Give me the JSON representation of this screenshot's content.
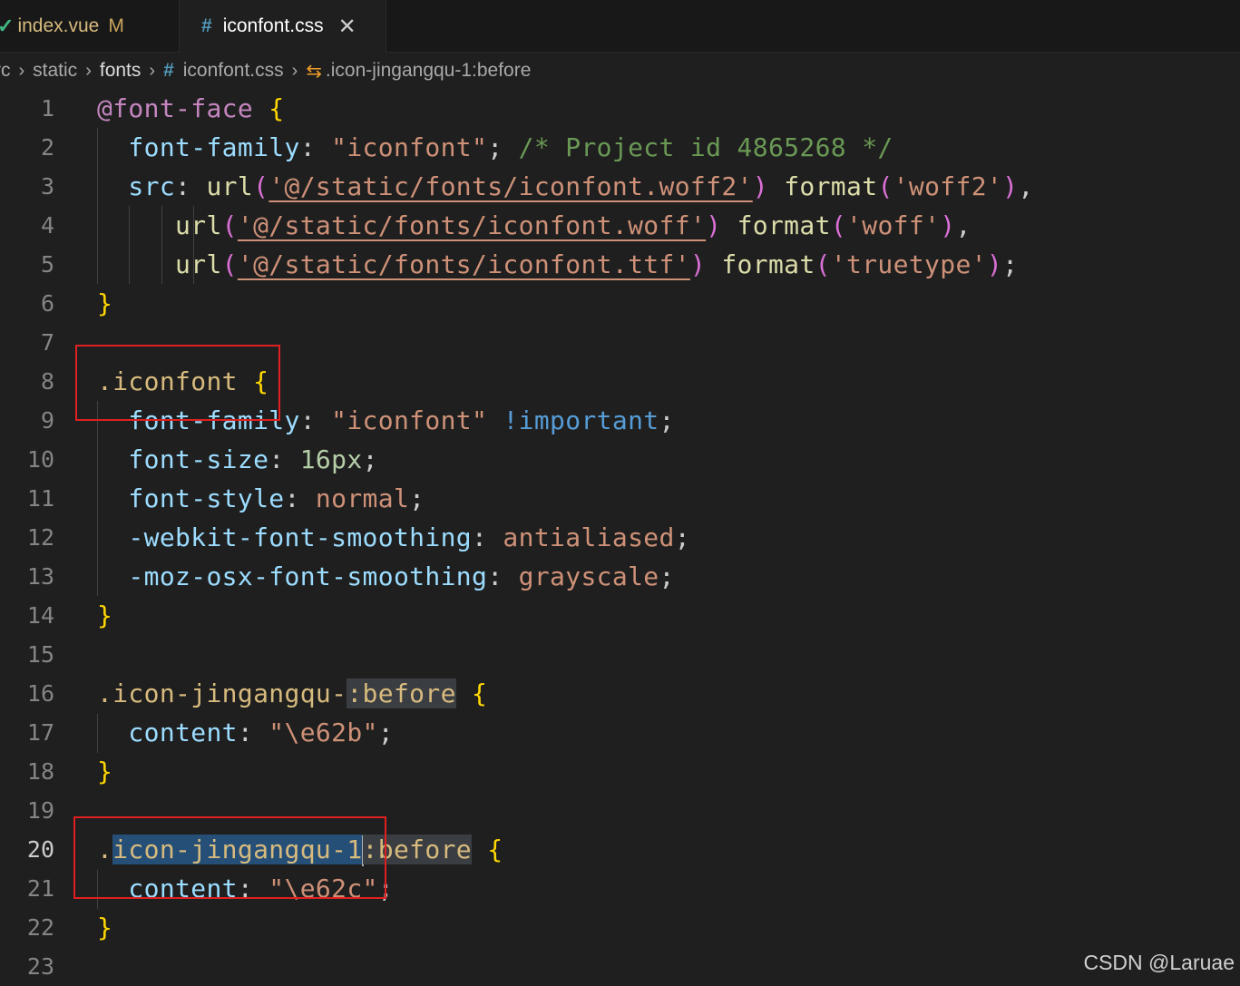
{
  "tabs": [
    {
      "icon": "✓",
      "label": "index.vue",
      "modified": "M"
    },
    {
      "icon": "#",
      "label": "iconfont.css",
      "close": "✕"
    }
  ],
  "breadcrumb": {
    "items": [
      "rc",
      "static",
      "fonts"
    ],
    "file_hash": "#",
    "file": "iconfont.css",
    "symbol_icon": "⇆",
    "symbol": ".icon-jingangqu-1:before"
  },
  "line_numbers": [
    "1",
    "2",
    "3",
    "4",
    "5",
    "6",
    "7",
    "8",
    "9",
    "10",
    "11",
    "12",
    "13",
    "14",
    "15",
    "16",
    "17",
    "18",
    "19",
    "20",
    "21",
    "22",
    "23"
  ],
  "active_line": "20",
  "code_lines": [
    "@font-face {",
    "  font-family: \"iconfont\"; /* Project id 4865268 */",
    "  src: url('@/static/fonts/iconfont.woff2') format('woff2'),",
    "       url('@/static/fonts/iconfont.woff') format('woff'),",
    "       url('@/static/fonts/iconfont.ttf') format('truetype');",
    "}",
    "",
    ".iconfont {",
    "  font-family: \"iconfont\" !important;",
    "  font-size: 16px;",
    "  font-style: normal;",
    "  -webkit-font-smoothing: antialiased;",
    "  -moz-osx-font-smoothing: grayscale;",
    "}",
    "",
    ".icon-jingangqu-:before {",
    "  content: \"\\e62b\";",
    "}",
    "",
    ".icon-jingangqu-1:before {",
    "  content: \"\\e62c\";",
    "}",
    ""
  ],
  "colors": {
    "background": "#1f1f1f",
    "selector": "#d7ba7d",
    "property": "#9cdcfe",
    "string": "#ce9178",
    "comment": "#6a9955",
    "annotation_box": "#e02020"
  },
  "watermark": "CSDN @Laruae"
}
